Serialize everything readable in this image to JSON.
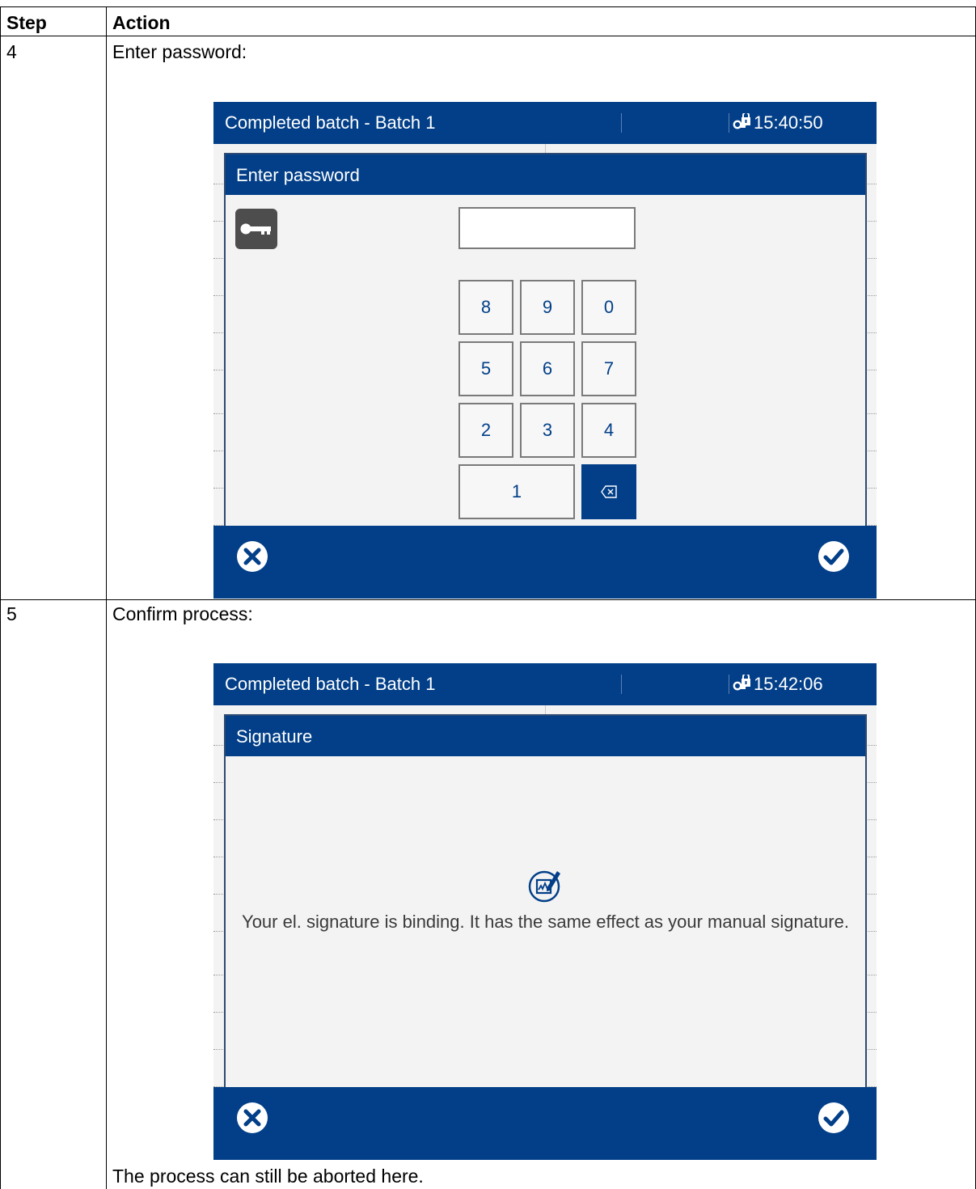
{
  "table": {
    "header": {
      "step": "Step",
      "action": "Action"
    },
    "rows": [
      {
        "step": "4",
        "action": "Enter password:"
      },
      {
        "step": "5",
        "action": "Confirm process:",
        "note": "The process can still be aborted here."
      }
    ]
  },
  "screen1": {
    "title": "Completed batch - Batch 1",
    "time": "15:40:50",
    "dialog_title": "Enter password",
    "password_value": "",
    "keys": [
      "8",
      "9",
      "0",
      "5",
      "6",
      "7",
      "2",
      "3",
      "4",
      "1"
    ],
    "backspace_label": "⌫"
  },
  "screen2": {
    "title": "Completed batch - Batch 1",
    "time": "15:42:06",
    "dialog_title": "Signature",
    "message": "Your el. signature is binding. It has the same effect as your manual signature."
  },
  "colors": {
    "accent": "#023f88",
    "screen_bg": "#f3f3f3",
    "key_text": "#023f88"
  },
  "icons": {
    "cancel": "close-circle-icon",
    "confirm": "checkmark-circle-icon",
    "lock": "lock-key-icon",
    "key": "key-icon",
    "signature": "signature-icon",
    "backspace": "backspace-icon"
  }
}
